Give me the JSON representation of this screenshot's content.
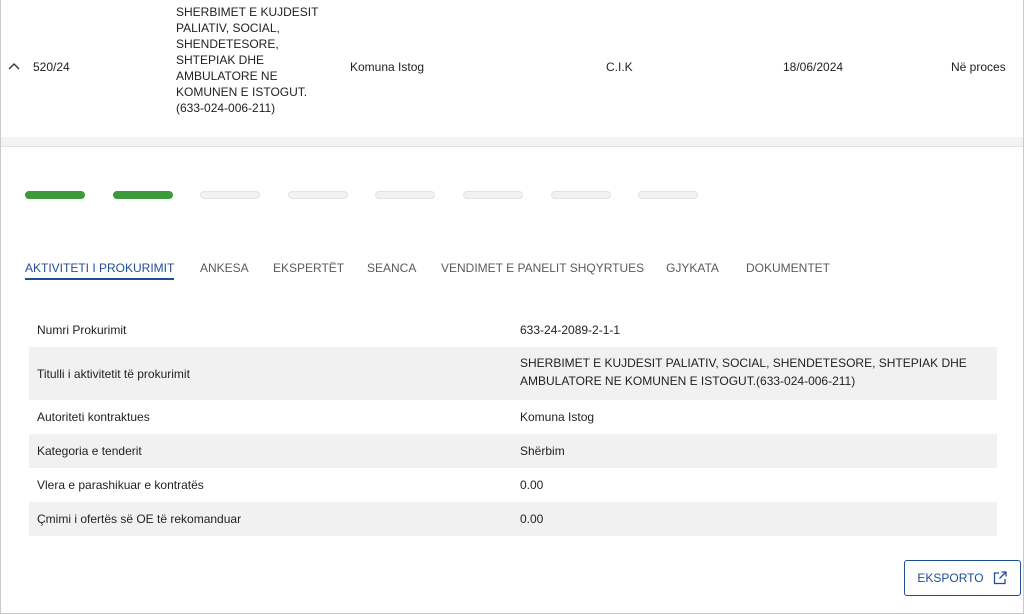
{
  "row": {
    "number": "520/24",
    "title": "SHERBIMET E KUJDESIT PALIATIV, SOCIAL, SHENDETESORE, SHTEPIAK DHE AMBULATORE NE KOMUNEN E ISTOGUT. (633-024-006-211)",
    "authority": "Komuna Istog",
    "operator": "C.I.K",
    "date": "18/06/2024",
    "status": "Në proces"
  },
  "steps": {
    "completed": 2,
    "total": 8
  },
  "tabs": [
    "AKTIVITETI I PROKURIMIT",
    "ANKESA",
    "EKSPERTËT",
    "SEANCA",
    "VENDIMET E PANELIT SHQYRTUES",
    "GJYKATA",
    "DOKUMENTET"
  ],
  "details": [
    {
      "label": "Numri Prokurimit",
      "value": "633-24-2089-2-1-1"
    },
    {
      "label": "Titulli i aktivitetit të prokurimit",
      "value": "SHERBIMET E KUJDESIT PALIATIV, SOCIAL, SHENDETESORE, SHTEPIAK DHE AMBULATORE NE KOMUNEN E ISTOGUT.(633-024-006-211)"
    },
    {
      "label": "Autoriteti kontraktues",
      "value": "Komuna Istog"
    },
    {
      "label": "Kategoria e tenderit",
      "value": "Shërbim"
    },
    {
      "label": "Vlera e parashikuar e kontratës",
      "value": "0.00"
    },
    {
      "label": "Çmimi i ofertës së OE të rekomanduar",
      "value": "0.00"
    }
  ],
  "export_label": "EKSPORTO",
  "colors": {
    "accent": "#1f4e96",
    "progress_done": "#3d9a3a",
    "status": "#e8962f"
  }
}
